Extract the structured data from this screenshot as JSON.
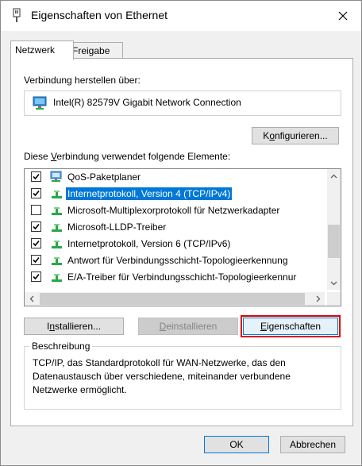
{
  "window": {
    "title": "Eigenschaften von Ethernet"
  },
  "tabs": [
    {
      "label": "Netzwerk",
      "active": true
    },
    {
      "label": "Freigabe",
      "active": false
    }
  ],
  "connection": {
    "label_pre": "Verbindung herstellen über:",
    "adapter": "Intel(R) 82579V Gigabit Network Connection",
    "configure_pre": "K",
    "configure_acc": "o",
    "configure_post": "nfigurieren..."
  },
  "elements": {
    "label_pre": "Diese ",
    "label_acc": "V",
    "label_post": "erbindung verwendet folgende Elemente:",
    "items": [
      {
        "label": "QoS-Paketplaner",
        "checked": true,
        "icon": "qos-icon",
        "selected": false
      },
      {
        "label": "Internetprotokoll, Version 4 (TCP/IPv4)",
        "checked": true,
        "icon": "protocol-icon",
        "selected": true
      },
      {
        "label": "Microsoft-Multiplexorprotokoll für Netzwerkadapter",
        "checked": false,
        "icon": "protocol-icon",
        "selected": false
      },
      {
        "label": "Microsoft-LLDP-Treiber",
        "checked": true,
        "icon": "protocol-icon",
        "selected": false
      },
      {
        "label": "Internetprotokoll, Version 6 (TCP/IPv6)",
        "checked": true,
        "icon": "protocol-icon",
        "selected": false
      },
      {
        "label": "Antwort für Verbindungsschicht-Topologieerkennung",
        "checked": true,
        "icon": "protocol-icon",
        "selected": false
      },
      {
        "label": "E/A-Treiber für Verbindungsschicht-Topologieerkennur",
        "checked": true,
        "icon": "protocol-icon",
        "selected": false
      }
    ]
  },
  "buttons": {
    "install_pre": "I",
    "install_acc": "n",
    "install_post": "stallieren...",
    "uninstall_pre": "",
    "uninstall_acc": "D",
    "uninstall_post": "einstallieren",
    "properties_pre": "",
    "properties_acc": "E",
    "properties_post": "igenschaften"
  },
  "description": {
    "legend": "Beschreibung",
    "text": "TCP/IP, das Standardprotokoll für WAN-Netzwerke, das den Datenaustausch über verschiedene, miteinander verbundene Netzwerke ermöglicht."
  },
  "footer": {
    "ok": "OK",
    "cancel": "Abbrechen"
  },
  "colors": {
    "selection": "#0078d7",
    "highlight_border": "#e00000"
  }
}
